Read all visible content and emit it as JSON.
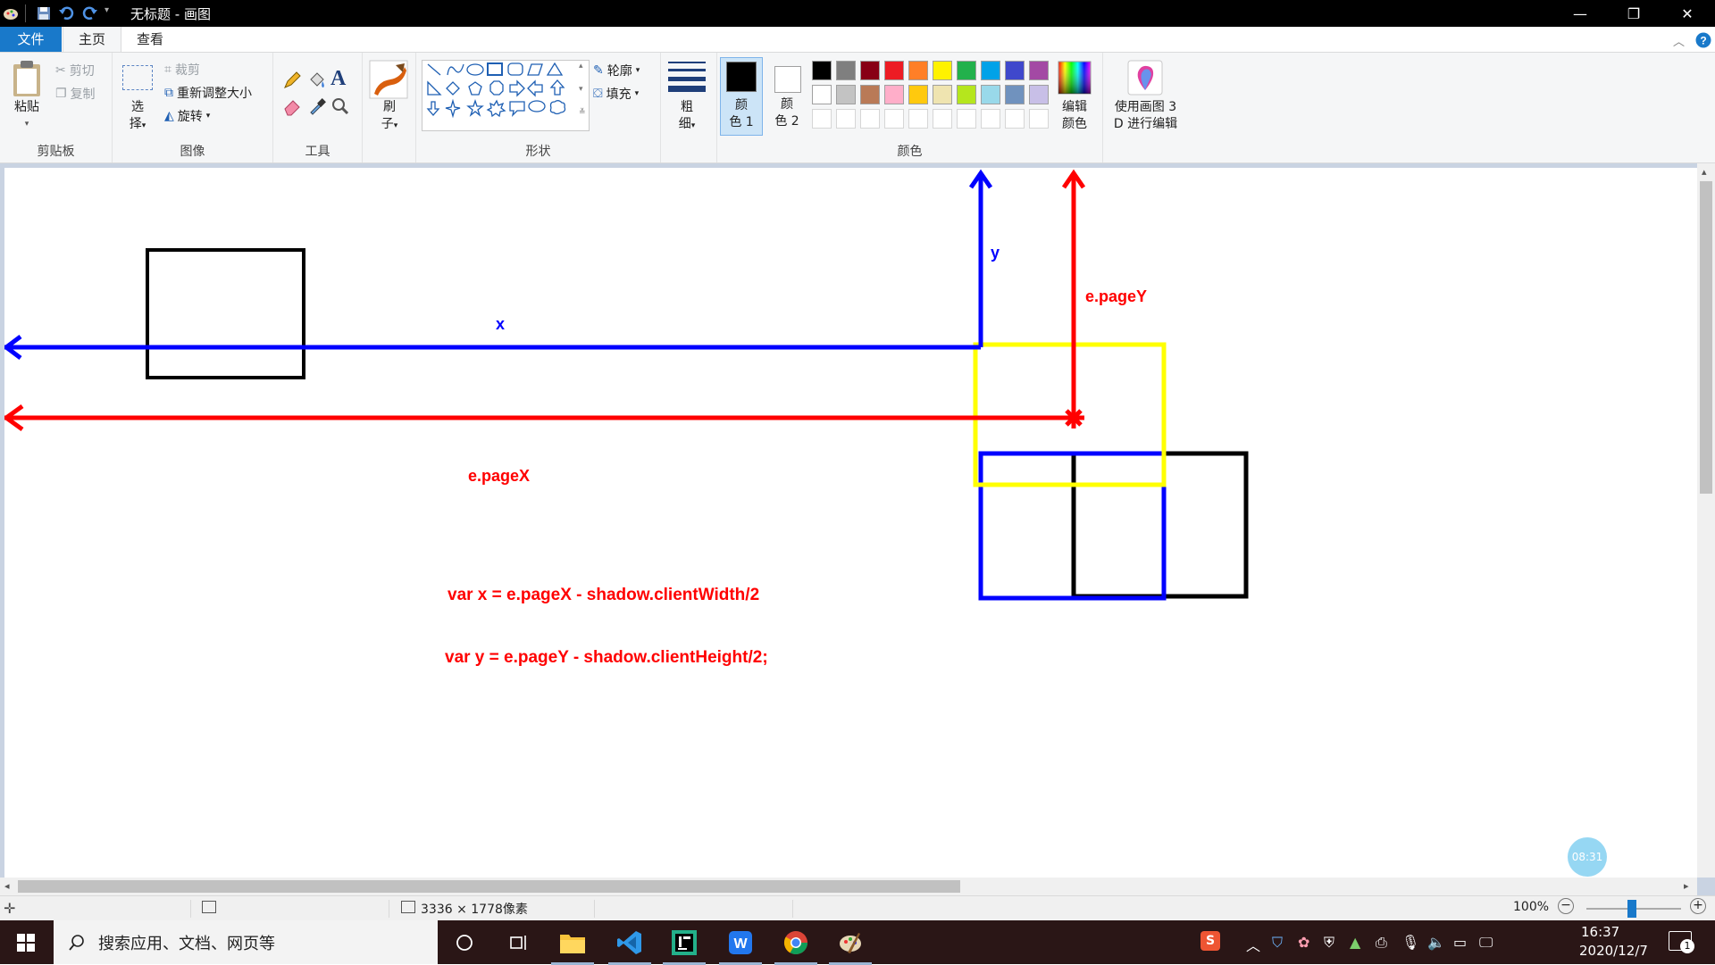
{
  "window": {
    "title": "无标题 - 画图",
    "minimize_glyph": "—",
    "maximize_glyph": "❐",
    "close_glyph": "✕"
  },
  "tabs": {
    "file": "文件",
    "home": "主页",
    "view": "查看"
  },
  "ribbon": {
    "clipboard": {
      "paste": "粘贴",
      "cut": "剪切",
      "copy": "复制",
      "label": "剪贴板"
    },
    "image": {
      "select_1": "选",
      "select_2": "择",
      "crop": "裁剪",
      "resize": "重新调整大小",
      "rotate": "旋转",
      "label": "图像"
    },
    "tools": {
      "label": "工具"
    },
    "brushes": {
      "label_1": "刷",
      "label_2": "子"
    },
    "shapes": {
      "outline": "轮廓",
      "fill": "填充",
      "label": "形状"
    },
    "size": {
      "label_1": "粗",
      "label_2": "细"
    },
    "colors": {
      "color1_1": "颜",
      "color1_2": "色 1",
      "color2_1": "颜",
      "color2_2": "色 2",
      "edit_1": "编辑",
      "edit_2": "颜色",
      "label": "颜色",
      "row1": [
        "#000000",
        "#7f7f7f",
        "#880015",
        "#ed1c24",
        "#ff7f27",
        "#fff200",
        "#22b14c",
        "#00a2e8",
        "#3f48cc",
        "#a349a4"
      ],
      "row2": [
        "#ffffff",
        "#c3c3c3",
        "#b97a57",
        "#ffaec9",
        "#ffc90e",
        "#efe4b0",
        "#b5e61d",
        "#99d9ea",
        "#7092be",
        "#c8bfe7"
      ]
    },
    "paint3d": {
      "line1": "使用画图 3",
      "line2": "D 进行编辑"
    }
  },
  "canvas_text": {
    "x_label": "x",
    "y_label": "y",
    "pagex_label": "e.pageX",
    "pagey_label": "e.pageY",
    "code_x": "var x = e.pageX - shadow.clientWidth/2",
    "code_y": "var y = e.pageY - shadow.clientHeight/2;"
  },
  "drawing_colors": {
    "blue": "#0000ff",
    "red": "#ff0000",
    "yellow": "#ffff00",
    "black": "#000000"
  },
  "status": {
    "dimensions": "3336 × 1778像素",
    "zoom": "100%"
  },
  "timer": "08:31",
  "taskbar": {
    "search_placeholder": "搜索应用、文档、网页等",
    "time": "16:37",
    "date": "2020/12/7",
    "ime_glyph": "S",
    "notification_count": "1"
  }
}
